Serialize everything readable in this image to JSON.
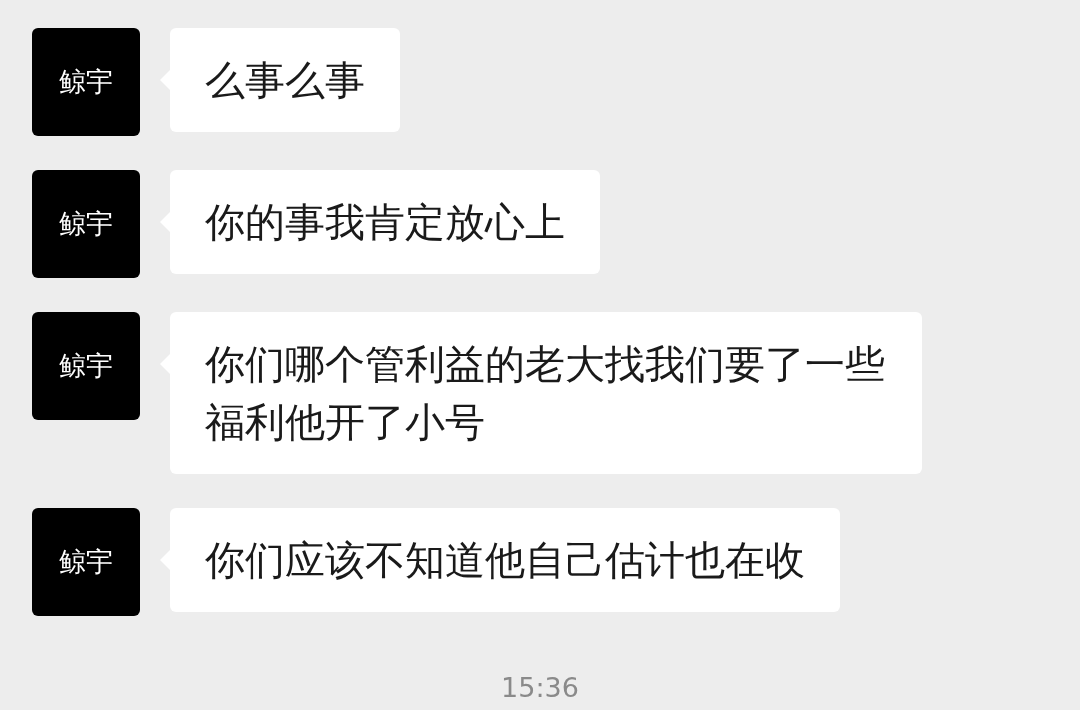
{
  "messages": [
    {
      "sender": "鲸宇",
      "text": "么事么事"
    },
    {
      "sender": "鲸宇",
      "text": "你的事我肯定放心上"
    },
    {
      "sender": "鲸宇",
      "text": "你们哪个管利益的老大找我们要了一些福利他开了小号"
    },
    {
      "sender": "鲸宇",
      "text": "你们应该不知道他自己估计也在收"
    }
  ],
  "timestamp": "15:36"
}
